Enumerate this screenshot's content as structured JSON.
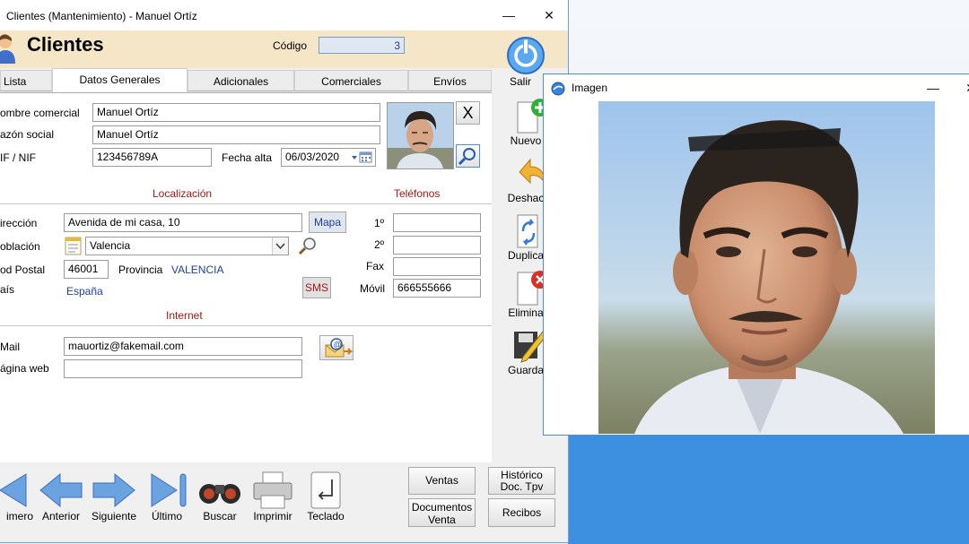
{
  "window": {
    "title": "Clientes (Mantenimiento) - Manuel Ortíz",
    "minimize": "—",
    "close": "✕"
  },
  "header": {
    "title": "Clientes",
    "codigo_label": "Código",
    "codigo_value": "3"
  },
  "tabs": [
    "Lista",
    "Datos Generales",
    "Adicionales",
    "Comerciales",
    "Envíos"
  ],
  "general": {
    "nombre_label": "ombre comercial",
    "nombre_value": "Manuel Ortíz",
    "razon_label": "azón social",
    "razon_value": "Manuel Ortíz",
    "nif_label": "IF / NIF",
    "nif_value": "123456789A",
    "fecha_label": "Fecha alta",
    "fecha_value": "06/03/2020",
    "photo_clear": "X"
  },
  "localizacion": {
    "section_title": "Localización",
    "direccion_label": "irección",
    "direccion_value": "Avenida de mi casa, 10",
    "mapa_button": "Mapa",
    "poblacion_label": "oblación",
    "poblacion_value": "Valencia",
    "cp_label": "od Postal",
    "cp_value": "46001",
    "provincia_label": "Provincia",
    "provincia_value": "VALENCIA",
    "pais_label": "aís",
    "pais_value": "España",
    "sms_button": "SMS"
  },
  "telefonos": {
    "section_title": "Teléfonos",
    "t1_label": "1º",
    "t1_value": "",
    "t2_label": "2º",
    "t2_value": "",
    "fax_label": "Fax",
    "fax_value": "",
    "movil_label": "Móvil",
    "movil_value": "666555666"
  },
  "internet": {
    "section_title": "Internet",
    "email_label": "Mail",
    "email_value": "mauortiz@fakemail.com",
    "web_label": "ágina web",
    "web_value": ""
  },
  "side_toolbar": {
    "salir": "Salir",
    "nuevo": "Nuevo",
    "deshacer": "Deshac",
    "duplicar": "Duplica",
    "eliminar": "Elimina",
    "guardar": "Guarda"
  },
  "nav_toolbar": {
    "primero": "imero",
    "anterior": "Anterior",
    "siguiente": "Siguiente",
    "ultimo": "Último",
    "buscar": "Buscar",
    "imprimir": "Imprimir",
    "teclado": "Teclado"
  },
  "action_buttons": {
    "ventas": "Ventas",
    "historico_l1": "Histórico",
    "historico_l2": "Doc. Tpv",
    "documentos_l1": "Documentos",
    "documentos_l2": "Venta",
    "recibos": "Recibos"
  },
  "image_window": {
    "title": "Imagen",
    "minimize": "—",
    "close": "✕"
  },
  "colors": {
    "header_bg": "#f6e6c8",
    "section_title": "#a01818",
    "link": "#1f3f9a",
    "window_border": "#4a8fd8"
  }
}
